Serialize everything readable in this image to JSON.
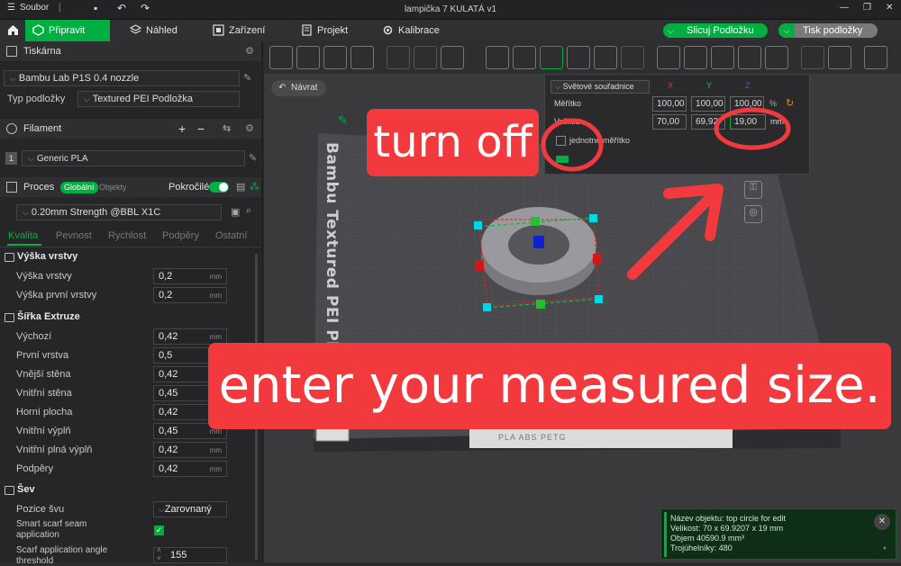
{
  "titlebar": {
    "menu_label": "Soubor",
    "title": "lampička 7 KULATÁ v1"
  },
  "tabs": [
    {
      "label": "Připravit"
    },
    {
      "label": "Náhled"
    },
    {
      "label": "Zařízení"
    },
    {
      "label": "Projekt"
    },
    {
      "label": "Kalibrace"
    }
  ],
  "actions": {
    "slice": "Slicuj Podložku",
    "print": "Tisk podložky"
  },
  "sidebar": {
    "printer_header": "Tiskárna",
    "printer_name": "Bambu Lab P1S 0.4 nozzle",
    "plate_type_label": "Typ podložky",
    "plate_type_value": "Textured PEI Podložka",
    "filament_header": "Filament",
    "filament_index": "1",
    "filament_value": "Generic PLA",
    "process_header": "Proces",
    "global_tab": "Globální",
    "objects_tab": "Objekty",
    "advanced_label": "Pokročilé",
    "process_value": "0.20mm Strength @BBL X1C",
    "subtabs": [
      "Kvalita",
      "Pevnost",
      "Rychlost",
      "Podpěry",
      "Ostatní"
    ],
    "groups": {
      "layer_height": "Výška vrstvy",
      "extrusion_width": "Šířka Extruze",
      "seam": "Šev"
    },
    "layer_rows": [
      {
        "label": "Výška vrstvy",
        "value": "0,2",
        "unit": "mm"
      },
      {
        "label": "Výška první vrstvy",
        "value": "0,2",
        "unit": "mm"
      }
    ],
    "width_rows": [
      {
        "label": "Výchozí",
        "value": "0,42",
        "unit": "mm"
      },
      {
        "label": "První vrstva",
        "value": "0,5",
        "unit": "mm"
      },
      {
        "label": "Vnější stěna",
        "value": "0,42",
        "unit": "mm"
      },
      {
        "label": "Vnitřní stěna",
        "value": "0,45",
        "unit": "mm"
      },
      {
        "label": "Horní plocha",
        "value": "0,42",
        "unit": "mm"
      },
      {
        "label": "Vnitřní výplň",
        "value": "0,45",
        "unit": "mm"
      },
      {
        "label": "Vnitřní plná výplň",
        "value": "0,42",
        "unit": "mm"
      },
      {
        "label": "Podpěry",
        "value": "0,42",
        "unit": "mm"
      }
    ],
    "seam_position_label": "Pozice švu",
    "seam_position_value": "Zarovnaný",
    "scarf_label_1": "Smart scarf seam",
    "scarf_label_2": "application",
    "angle_label_1": "Scarf application angle",
    "angle_label_2": "threshold",
    "angle_value": "155"
  },
  "viewport": {
    "back_button": "Návrat",
    "plate_text": "Bambu Textured PEI Plate",
    "plate_bottom_text": "PLA ABS PETG",
    "panel": {
      "coord_dropdown": "Světové souřadnice",
      "x_label": "X",
      "y_label": "Y",
      "z_label": "Z",
      "scale_label": "Měřítko",
      "size_label": "Velikost",
      "scale_x": "100,00",
      "scale_y": "100,00",
      "scale_z": "100,00",
      "scale_unit": "%",
      "size_x": "70,00",
      "size_y": "69,92",
      "size_z": "19,00",
      "size_unit": "mm",
      "uniform_label": "jednotné měřítko"
    },
    "annotation_turn_off": "turn off",
    "annotation_enter": "enter your measured size.",
    "info": {
      "name": "Název objektu: top circle for edit",
      "size": "Velikost: 70 x 69.9207 x 19 mm",
      "volume": "Objem 40590.9 mm³",
      "triangles": "Trojúhelníky: 480"
    }
  },
  "colors": {
    "accent": "#00ae42",
    "annotation": "#f2393d"
  }
}
